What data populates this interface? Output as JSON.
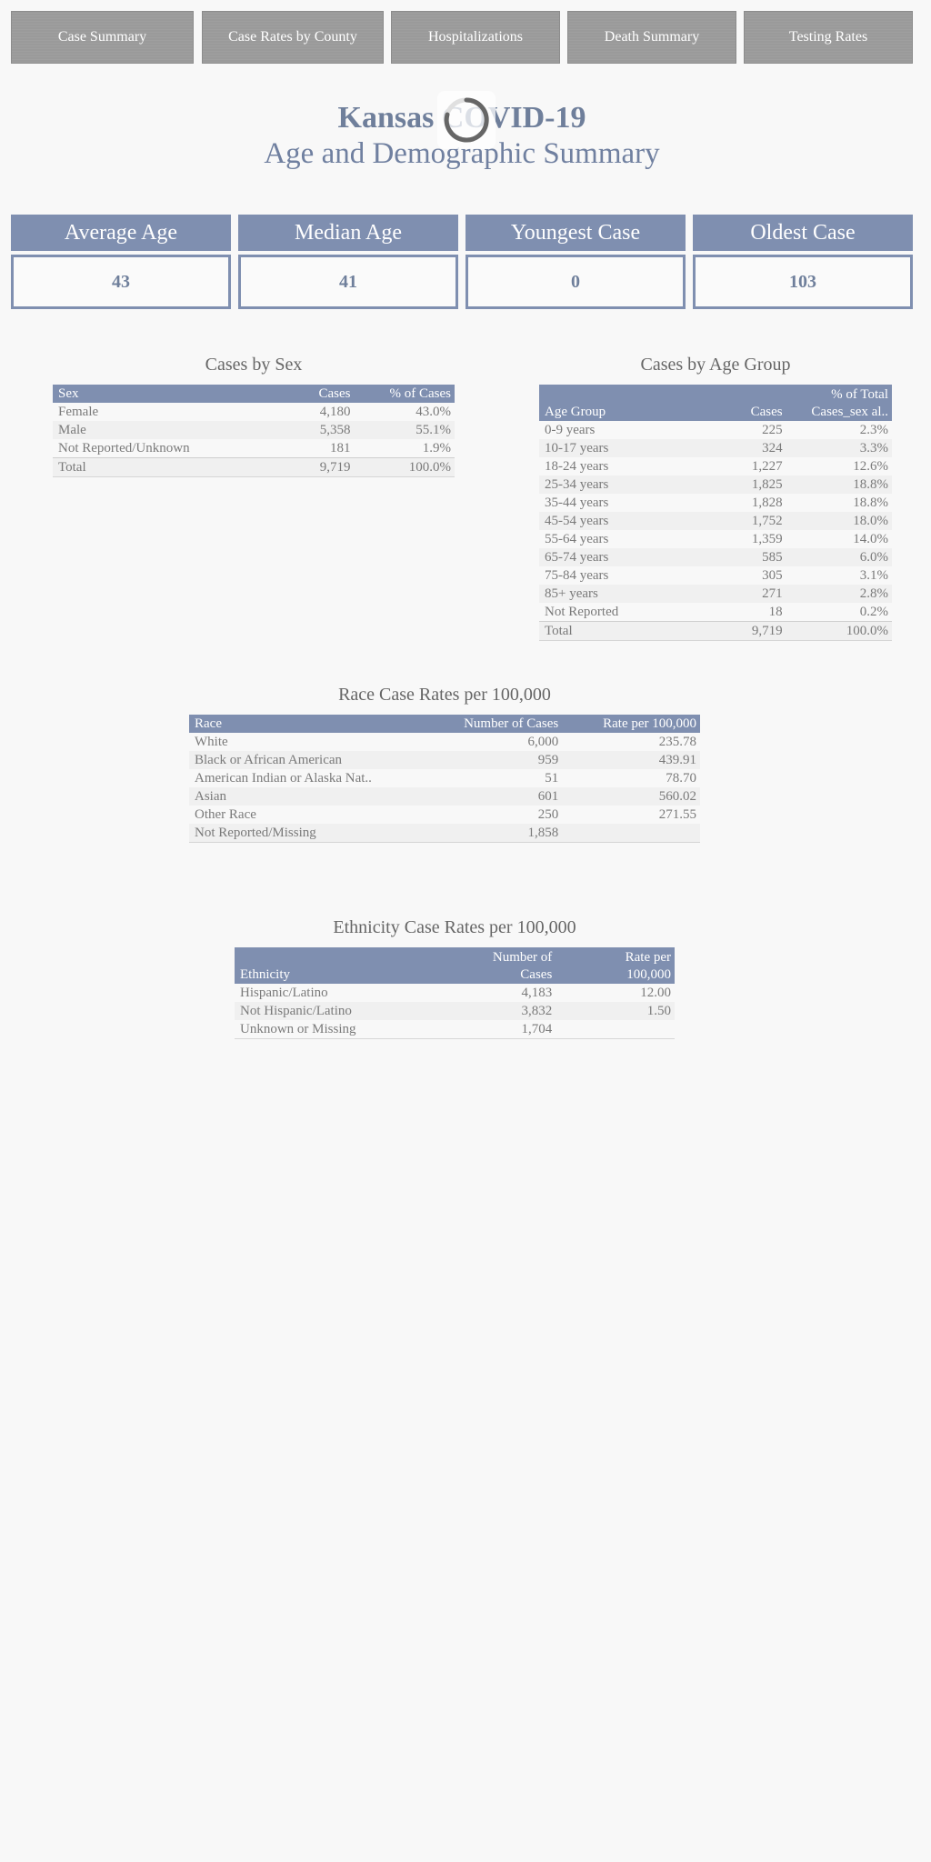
{
  "nav": {
    "items": [
      {
        "label": "Case Summary"
      },
      {
        "label": "Case Rates by County"
      },
      {
        "label": "Hospitalizations"
      },
      {
        "label": "Death Summary"
      },
      {
        "label": "Testing Rates"
      }
    ]
  },
  "header": {
    "title": "Kansas COVID-19",
    "subtitle": "Age and Demographic Summary"
  },
  "kpis": [
    {
      "label": "Average Age",
      "value": "43"
    },
    {
      "label": "Median Age",
      "value": "41"
    },
    {
      "label": "Youngest Case",
      "value": "0"
    },
    {
      "label": "Oldest Case",
      "value": "103"
    }
  ],
  "sex_table": {
    "title": "Cases by Sex",
    "headers": [
      "Sex",
      "Cases",
      "% of Cases"
    ],
    "rows": [
      [
        "Female",
        "4,180",
        "43.0%"
      ],
      [
        "Male",
        "5,358",
        "55.1%"
      ],
      [
        "Not Reported/Unknown",
        "181",
        "1.9%"
      ],
      [
        "Total",
        "9,719",
        "100.0%"
      ]
    ]
  },
  "age_table": {
    "title": "Cases by Age Group",
    "headers": [
      "Age Group",
      "Cases",
      "% of Total",
      "Cases_sex al.."
    ],
    "rows": [
      [
        "0-9 years",
        "225",
        "2.3%"
      ],
      [
        "10-17 years",
        "324",
        "3.3%"
      ],
      [
        "18-24 years",
        "1,227",
        "12.6%"
      ],
      [
        "25-34 years",
        "1,825",
        "18.8%"
      ],
      [
        "35-44 years",
        "1,828",
        "18.8%"
      ],
      [
        "45-54 years",
        "1,752",
        "18.0%"
      ],
      [
        "55-64 years",
        "1,359",
        "14.0%"
      ],
      [
        "65-74 years",
        "585",
        "6.0%"
      ],
      [
        "75-84 years",
        "305",
        "3.1%"
      ],
      [
        "85+ years",
        "271",
        "2.8%"
      ],
      [
        "Not Reported",
        "18",
        "0.2%"
      ],
      [
        "Total",
        "9,719",
        "100.0%"
      ]
    ]
  },
  "race_table": {
    "title": "Race Case Rates per 100,000",
    "headers": [
      "Race",
      "Number of Cases",
      "Rate per 100,000"
    ],
    "rows": [
      [
        "White",
        "6,000",
        "235.78"
      ],
      [
        "Black or African American",
        "959",
        "439.91"
      ],
      [
        "American Indian or Alaska Nat..",
        "51",
        "78.70"
      ],
      [
        "Asian",
        "601",
        "560.02"
      ],
      [
        "Other Race",
        "250",
        "271.55"
      ],
      [
        "Not Reported/Missing",
        "1,858",
        ""
      ]
    ]
  },
  "eth_table": {
    "title": "Ethnicity Case Rates per 100,000",
    "headers": [
      "Ethnicity",
      "Number of",
      "Cases",
      "Rate per",
      "100,000"
    ],
    "rows": [
      [
        "Hispanic/Latino",
        "4,183",
        "12.00"
      ],
      [
        "Not Hispanic/Latino",
        "3,832",
        "1.50"
      ],
      [
        "Unknown or Missing",
        "1,704",
        ""
      ]
    ]
  },
  "colors": {
    "accent": "#7f8fb0",
    "nav_bg": "#9a9a9a",
    "title": "#6f7f9b",
    "background": "#f8f8f8"
  }
}
